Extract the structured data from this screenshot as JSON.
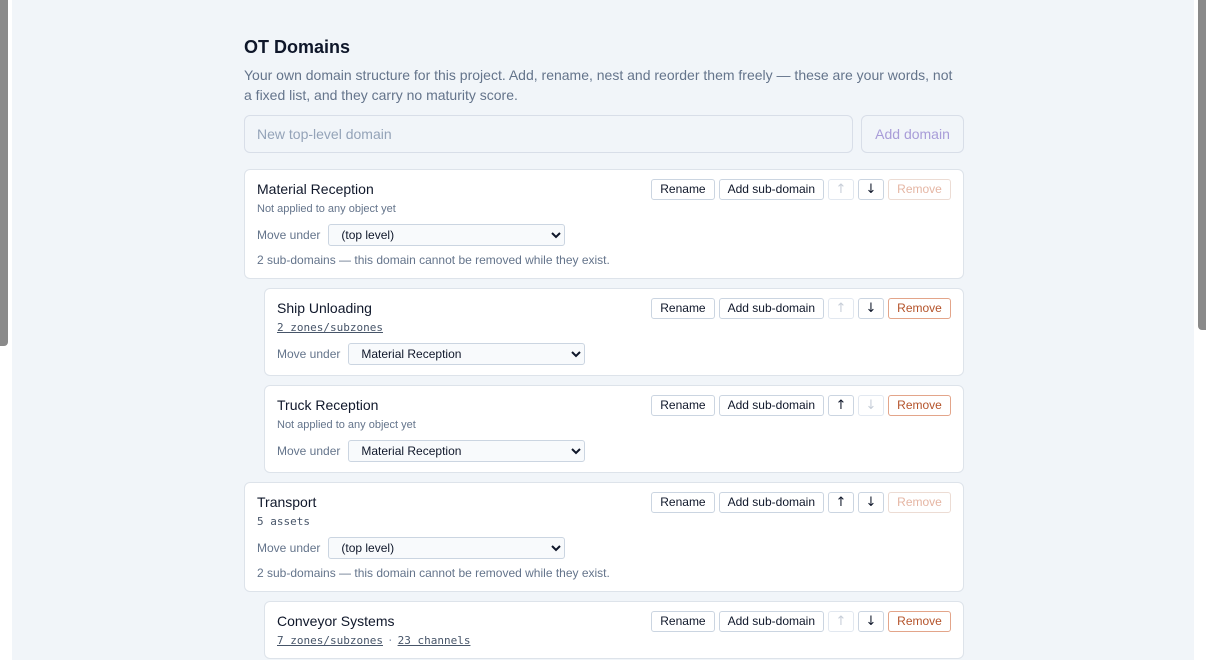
{
  "header": {
    "title": "OT Domains",
    "description": "Your own domain structure for this project. Add, rename, nest and reorder them freely — these are your words, not a fixed list, and they carry no maturity score."
  },
  "add_form": {
    "placeholder": "New top-level domain",
    "button_label": "Add domain"
  },
  "labels": {
    "rename": "Rename",
    "add_sub": "Add sub-domain",
    "remove": "Remove",
    "move_under": "Move under",
    "up_glyph": "↑",
    "down_glyph": "↓"
  },
  "domains": [
    {
      "name": "Material Reception",
      "usage": "Not applied to any object yet",
      "move_value": "(top level)",
      "note": "2 sub-domains — this domain cannot be removed while they exist."
    },
    {
      "name": "Ship Unloading",
      "usage_links": [
        "2 zones/subzones"
      ],
      "move_value": "Material Reception"
    },
    {
      "name": "Truck Reception",
      "usage": "Not applied to any object yet",
      "move_value": "Material Reception"
    },
    {
      "name": "Transport",
      "usage_mono": "5 assets",
      "move_value": "(top level)",
      "note": "2 sub-domains — this domain cannot be removed while they exist."
    },
    {
      "name": "Conveyor Systems",
      "usage_links": [
        "7 zones/subzones",
        "23 channels"
      ],
      "usage_sep": "·"
    }
  ]
}
